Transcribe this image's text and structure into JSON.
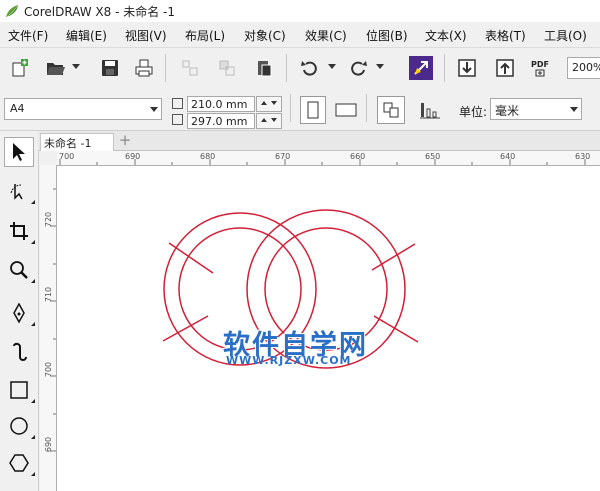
{
  "window": {
    "title": "CorelDRAW X8 - 未命名 -1"
  },
  "menu": [
    "文件(F)",
    "编辑(E)",
    "视图(V)",
    "布局(L)",
    "对象(C)",
    "效果(C)",
    "位图(B)",
    "文本(X)",
    "表格(T)",
    "工具(O)"
  ],
  "toolbar": {
    "pdf_label": "PDF",
    "zoom": "200%",
    "buttons": [
      "new-document",
      "open",
      "save",
      "print",
      "import-disabled",
      "export-disabled",
      "publish",
      "undo",
      "redo",
      "corel-connect",
      "import",
      "export",
      "publish-pdf"
    ]
  },
  "property_bar": {
    "page_size": "A4",
    "width": "210.0 mm",
    "height": "297.0 mm",
    "unit_label": "单位:",
    "unit_value": "毫米"
  },
  "document": {
    "tab": "未命名 -1"
  },
  "rulers": {
    "horizontal": [
      "700",
      "690",
      "680",
      "670",
      "660",
      "650",
      "640",
      "630"
    ],
    "vertical": [
      "720",
      "710",
      "700",
      "690"
    ]
  },
  "toolbox": [
    "pick-tool",
    "shape-tool",
    "crop-tool",
    "zoom-tool",
    "freehand-tool",
    "artistic-media-tool",
    "rectangle-tool",
    "ellipse-tool",
    "polygon-tool"
  ],
  "watermark": {
    "main": "软件自学网",
    "sub": "WWW.RJZXW.COM"
  },
  "colors": {
    "stroke": "#d21f36",
    "accent": "#2a6fc7",
    "cursor": "#4b2a8c"
  }
}
